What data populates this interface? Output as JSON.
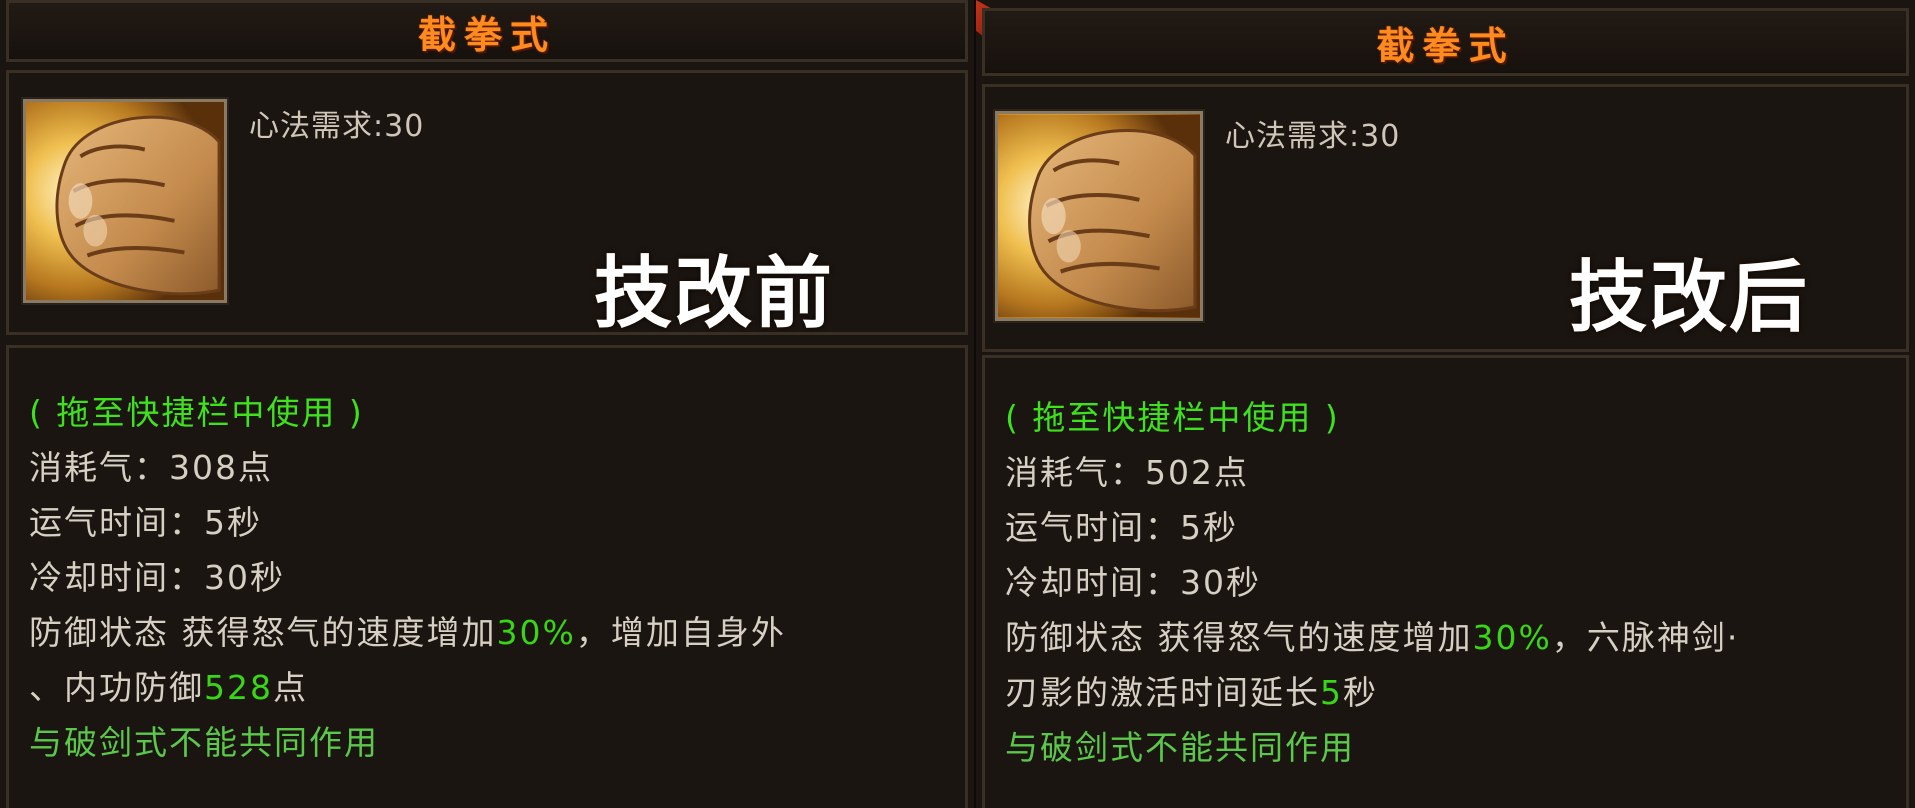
{
  "panels": [
    {
      "title": "截拳式",
      "requirement": "心法需求:30",
      "stamp": "技改前",
      "usage": "( 拖至快捷栏中使用 )",
      "cost": "消耗气：308点",
      "cast_time": "运气时间：5秒",
      "cooldown": "冷却时间：30秒",
      "effect_prefix": "防御状态  获得怒气的速度增加",
      "effect_value": "30%",
      "effect_suffix": "，增加自身外",
      "effect2_prefix": "、内功防御",
      "effect2_value": "528",
      "effect2_suffix": "点",
      "note": "与破剑式不能共同作用"
    },
    {
      "title": "截拳式",
      "requirement": "心法需求:30",
      "stamp": "技改后",
      "usage": "( 拖至快捷栏中使用 )",
      "cost": "消耗气：502点",
      "cast_time": "运气时间：5秒",
      "cooldown": "冷却时间：30秒",
      "effect_prefix": "防御状态  获得怒气的速度增加",
      "effect_value": "30%",
      "effect_suffix": "，六脉神剑·",
      "effect2_prefix": "刃影的激活时间延长",
      "effect2_value": "5",
      "effect2_suffix": "秒",
      "note": "与破剑式不能共同作用"
    }
  ],
  "icon": "fist-icon"
}
